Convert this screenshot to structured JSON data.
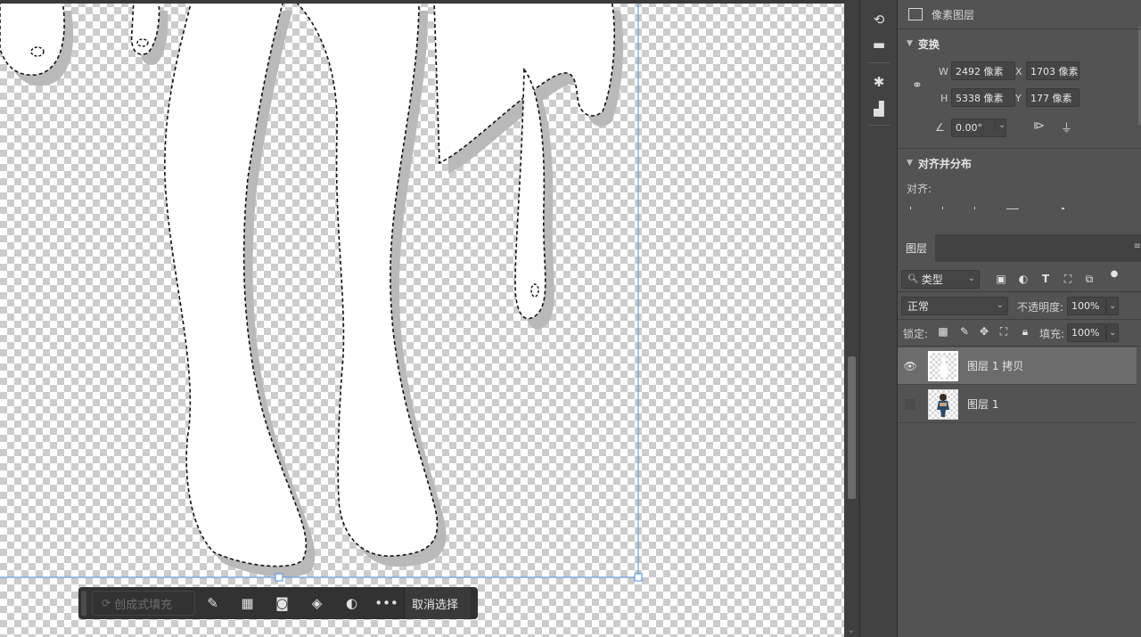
{
  "canvas": {
    "taskbar": {
      "generative_fill_placeholder": "创成式填充",
      "deselect_label": "取消选择"
    }
  },
  "properties": {
    "layer_type": "像素图层",
    "transform": {
      "title": "变换",
      "w_label": "W",
      "w_value": "2492 像素",
      "h_label": "H",
      "h_value": "5338 像素",
      "x_label": "X",
      "x_value": "1703 像素",
      "y_label": "Y",
      "y_value": "177 像素",
      "angle_value": "0.00°"
    },
    "align": {
      "title": "对齐并分布",
      "align_label": "对齐:"
    }
  },
  "layers_panel": {
    "tab_label": "图层",
    "filter_kind": "类型",
    "blend_mode": "正常",
    "opacity_label": "不透明度:",
    "opacity_value": "100%",
    "lock_label": "锁定:",
    "fill_label": "填充:",
    "fill_value": "100%",
    "layers": [
      {
        "name": "图层 1 拷贝",
        "visible": true,
        "selected": true
      },
      {
        "name": "图层 1",
        "visible": false,
        "selected": false
      }
    ]
  }
}
